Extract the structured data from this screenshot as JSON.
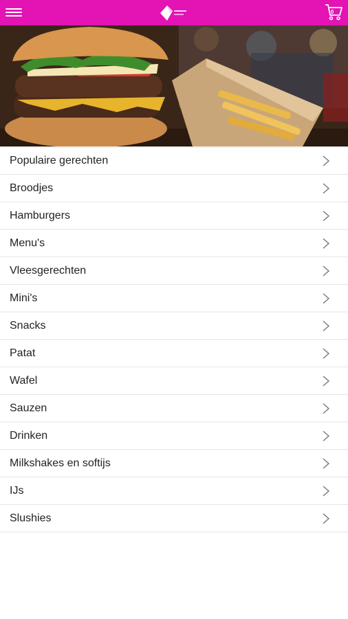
{
  "header": {
    "background": "#e313b4",
    "menu_icon": "hamburger-menu-icon",
    "logo_icon": "restaurant-logo",
    "cart_icon": "shopping-cart-icon",
    "cart_count": "0"
  },
  "hero": {
    "image": "burger-and-fries-photo"
  },
  "categories": [
    {
      "label": "Populaire gerechten"
    },
    {
      "label": "Broodjes"
    },
    {
      "label": "Hamburgers"
    },
    {
      "label": "Menu's"
    },
    {
      "label": "Vleesgerechten"
    },
    {
      "label": "Mini's"
    },
    {
      "label": "Snacks"
    },
    {
      "label": "Patat"
    },
    {
      "label": "Wafel"
    },
    {
      "label": "Sauzen"
    },
    {
      "label": "Drinken"
    },
    {
      "label": "Milkshakes en softijs"
    },
    {
      "label": "IJs"
    },
    {
      "label": "Slushies"
    }
  ]
}
